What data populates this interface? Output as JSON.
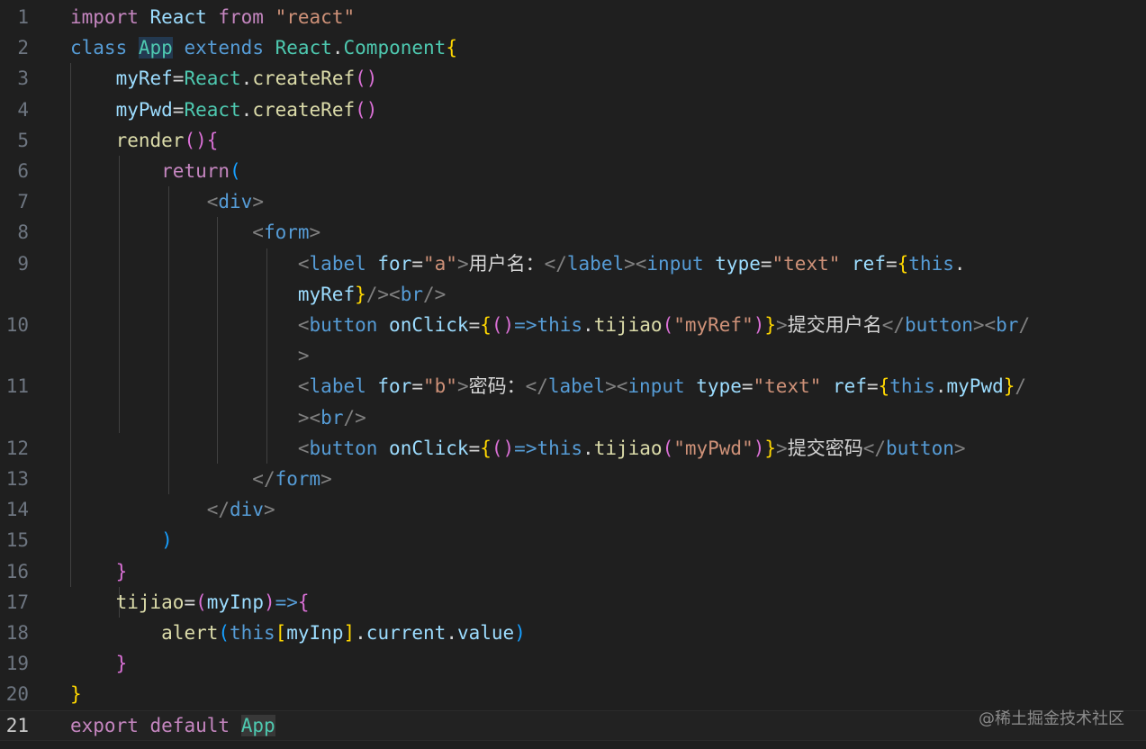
{
  "editor": {
    "current_line": "21",
    "watermark": "@稀土掘金技术社区",
    "lines": [
      {
        "num": "1",
        "tokens": [
          {
            "t": "import",
            "c": "kw-ctrl"
          },
          {
            "t": " React ",
            "c": "var"
          },
          {
            "t": "from",
            "c": "kw-ctrl"
          },
          {
            "t": " ",
            "c": "txt"
          },
          {
            "t": "\"react\"",
            "c": "str"
          }
        ]
      },
      {
        "num": "2",
        "tokens": [
          {
            "t": "class",
            "c": "kw"
          },
          {
            "t": " ",
            "c": "txt"
          },
          {
            "t": "App",
            "c": "cls hl"
          },
          {
            "t": " ",
            "c": "txt"
          },
          {
            "t": "extends",
            "c": "kw"
          },
          {
            "t": " ",
            "c": "txt"
          },
          {
            "t": "React",
            "c": "cls"
          },
          {
            "t": ".",
            "c": "txt"
          },
          {
            "t": "Component",
            "c": "cls"
          },
          {
            "t": "{",
            "c": "b1"
          }
        ]
      },
      {
        "num": "3",
        "tokens": [
          {
            "t": "    ",
            "c": "txt"
          },
          {
            "t": "myRef",
            "c": "var"
          },
          {
            "t": "=",
            "c": "op"
          },
          {
            "t": "React",
            "c": "cls"
          },
          {
            "t": ".",
            "c": "txt"
          },
          {
            "t": "createRef",
            "c": "fn"
          },
          {
            "t": "()",
            "c": "b2"
          }
        ]
      },
      {
        "num": "4",
        "tokens": [
          {
            "t": "    ",
            "c": "txt"
          },
          {
            "t": "myPwd",
            "c": "var"
          },
          {
            "t": "=",
            "c": "op"
          },
          {
            "t": "React",
            "c": "cls"
          },
          {
            "t": ".",
            "c": "txt"
          },
          {
            "t": "createRef",
            "c": "fn"
          },
          {
            "t": "()",
            "c": "b2"
          }
        ]
      },
      {
        "num": "5",
        "tokens": [
          {
            "t": "    ",
            "c": "txt"
          },
          {
            "t": "render",
            "c": "fn"
          },
          {
            "t": "(){",
            "c": "b2"
          }
        ]
      },
      {
        "num": "6",
        "tokens": [
          {
            "t": "        ",
            "c": "txt"
          },
          {
            "t": "return",
            "c": "kw-ctrl"
          },
          {
            "t": "(",
            "c": "b3"
          }
        ]
      },
      {
        "num": "7",
        "tokens": [
          {
            "t": "            ",
            "c": "txt"
          },
          {
            "t": "<",
            "c": "punc"
          },
          {
            "t": "div",
            "c": "tag"
          },
          {
            "t": ">",
            "c": "punc"
          }
        ]
      },
      {
        "num": "8",
        "tokens": [
          {
            "t": "                ",
            "c": "txt"
          },
          {
            "t": "<",
            "c": "punc"
          },
          {
            "t": "form",
            "c": "tag"
          },
          {
            "t": ">",
            "c": "punc"
          }
        ]
      },
      {
        "num": "9",
        "tokens": [
          {
            "t": "                    ",
            "c": "txt"
          },
          {
            "t": "<",
            "c": "punc"
          },
          {
            "t": "label",
            "c": "tag"
          },
          {
            "t": " ",
            "c": "txt"
          },
          {
            "t": "for",
            "c": "attr"
          },
          {
            "t": "=",
            "c": "op"
          },
          {
            "t": "\"a\"",
            "c": "str"
          },
          {
            "t": ">",
            "c": "punc"
          },
          {
            "t": "用户名：",
            "c": "txt"
          },
          {
            "t": "</",
            "c": "punc"
          },
          {
            "t": "label",
            "c": "tag"
          },
          {
            "t": "><",
            "c": "punc"
          },
          {
            "t": "input",
            "c": "tag"
          },
          {
            "t": " ",
            "c": "txt"
          },
          {
            "t": "type",
            "c": "attr"
          },
          {
            "t": "=",
            "c": "op"
          },
          {
            "t": "\"text\"",
            "c": "str"
          },
          {
            "t": " ",
            "c": "txt"
          },
          {
            "t": "ref",
            "c": "attr"
          },
          {
            "t": "=",
            "c": "op"
          },
          {
            "t": "{",
            "c": "b1"
          },
          {
            "t": "this",
            "c": "kw"
          },
          {
            "t": ".",
            "c": "txt"
          }
        ]
      },
      {
        "num": "",
        "tokens": [
          {
            "t": "                    ",
            "c": "txt"
          },
          {
            "t": "myRef",
            "c": "var"
          },
          {
            "t": "}",
            "c": "b1"
          },
          {
            "t": "/><",
            "c": "punc"
          },
          {
            "t": "br",
            "c": "tag"
          },
          {
            "t": "/>",
            "c": "punc"
          }
        ]
      },
      {
        "num": "10",
        "tokens": [
          {
            "t": "                    ",
            "c": "txt"
          },
          {
            "t": "<",
            "c": "punc"
          },
          {
            "t": "button",
            "c": "tag"
          },
          {
            "t": " ",
            "c": "txt"
          },
          {
            "t": "onClick",
            "c": "attr"
          },
          {
            "t": "=",
            "c": "op"
          },
          {
            "t": "{",
            "c": "b1"
          },
          {
            "t": "()",
            "c": "b2"
          },
          {
            "t": "=>",
            "c": "kw"
          },
          {
            "t": "this",
            "c": "kw"
          },
          {
            "t": ".",
            "c": "txt"
          },
          {
            "t": "tijiao",
            "c": "fn"
          },
          {
            "t": "(",
            "c": "b2"
          },
          {
            "t": "\"myRef\"",
            "c": "str"
          },
          {
            "t": ")",
            "c": "b2"
          },
          {
            "t": "}",
            "c": "b1"
          },
          {
            "t": ">",
            "c": "punc"
          },
          {
            "t": "提交用户名",
            "c": "txt"
          },
          {
            "t": "</",
            "c": "punc"
          },
          {
            "t": "button",
            "c": "tag"
          },
          {
            "t": "><",
            "c": "punc"
          },
          {
            "t": "br",
            "c": "tag"
          },
          {
            "t": "/",
            "c": "punc"
          }
        ]
      },
      {
        "num": "",
        "tokens": [
          {
            "t": "                    ",
            "c": "txt"
          },
          {
            "t": ">",
            "c": "punc"
          }
        ]
      },
      {
        "num": "11",
        "tokens": [
          {
            "t": "                    ",
            "c": "txt"
          },
          {
            "t": "<",
            "c": "punc"
          },
          {
            "t": "label",
            "c": "tag"
          },
          {
            "t": " ",
            "c": "txt"
          },
          {
            "t": "for",
            "c": "attr"
          },
          {
            "t": "=",
            "c": "op"
          },
          {
            "t": "\"b\"",
            "c": "str"
          },
          {
            "t": ">",
            "c": "punc"
          },
          {
            "t": "密码：",
            "c": "txt"
          },
          {
            "t": "</",
            "c": "punc"
          },
          {
            "t": "label",
            "c": "tag"
          },
          {
            "t": "><",
            "c": "punc"
          },
          {
            "t": "input",
            "c": "tag"
          },
          {
            "t": " ",
            "c": "txt"
          },
          {
            "t": "type",
            "c": "attr"
          },
          {
            "t": "=",
            "c": "op"
          },
          {
            "t": "\"text\"",
            "c": "str"
          },
          {
            "t": " ",
            "c": "txt"
          },
          {
            "t": "ref",
            "c": "attr"
          },
          {
            "t": "=",
            "c": "op"
          },
          {
            "t": "{",
            "c": "b1"
          },
          {
            "t": "this",
            "c": "kw"
          },
          {
            "t": ".",
            "c": "txt"
          },
          {
            "t": "myPwd",
            "c": "var"
          },
          {
            "t": "}",
            "c": "b1"
          },
          {
            "t": "/",
            "c": "punc"
          }
        ]
      },
      {
        "num": "",
        "tokens": [
          {
            "t": "                    ",
            "c": "txt"
          },
          {
            "t": "><",
            "c": "punc"
          },
          {
            "t": "br",
            "c": "tag"
          },
          {
            "t": "/>",
            "c": "punc"
          }
        ]
      },
      {
        "num": "12",
        "tokens": [
          {
            "t": "                    ",
            "c": "txt"
          },
          {
            "t": "<",
            "c": "punc"
          },
          {
            "t": "button",
            "c": "tag"
          },
          {
            "t": " ",
            "c": "txt"
          },
          {
            "t": "onClick",
            "c": "attr"
          },
          {
            "t": "=",
            "c": "op"
          },
          {
            "t": "{",
            "c": "b1"
          },
          {
            "t": "()",
            "c": "b2"
          },
          {
            "t": "=>",
            "c": "kw"
          },
          {
            "t": "this",
            "c": "kw"
          },
          {
            "t": ".",
            "c": "txt"
          },
          {
            "t": "tijiao",
            "c": "fn"
          },
          {
            "t": "(",
            "c": "b2"
          },
          {
            "t": "\"myPwd\"",
            "c": "str"
          },
          {
            "t": ")",
            "c": "b2"
          },
          {
            "t": "}",
            "c": "b1"
          },
          {
            "t": ">",
            "c": "punc"
          },
          {
            "t": "提交密码",
            "c": "txt"
          },
          {
            "t": "</",
            "c": "punc"
          },
          {
            "t": "button",
            "c": "tag"
          },
          {
            "t": ">",
            "c": "punc"
          }
        ]
      },
      {
        "num": "13",
        "tokens": [
          {
            "t": "                ",
            "c": "txt"
          },
          {
            "t": "</",
            "c": "punc"
          },
          {
            "t": "form",
            "c": "tag"
          },
          {
            "t": ">",
            "c": "punc"
          }
        ]
      },
      {
        "num": "14",
        "tokens": [
          {
            "t": "            ",
            "c": "txt"
          },
          {
            "t": "</",
            "c": "punc"
          },
          {
            "t": "div",
            "c": "tag"
          },
          {
            "t": ">",
            "c": "punc"
          }
        ]
      },
      {
        "num": "15",
        "tokens": [
          {
            "t": "        ",
            "c": "txt"
          },
          {
            "t": ")",
            "c": "b3"
          }
        ]
      },
      {
        "num": "16",
        "tokens": [
          {
            "t": "    ",
            "c": "txt"
          },
          {
            "t": "}",
            "c": "b2"
          }
        ]
      },
      {
        "num": "17",
        "tokens": [
          {
            "t": "    ",
            "c": "txt"
          },
          {
            "t": "tijiao",
            "c": "fn"
          },
          {
            "t": "=",
            "c": "op"
          },
          {
            "t": "(",
            "c": "b2"
          },
          {
            "t": "myInp",
            "c": "var"
          },
          {
            "t": ")",
            "c": "b2"
          },
          {
            "t": "=>",
            "c": "kw"
          },
          {
            "t": "{",
            "c": "b2"
          }
        ]
      },
      {
        "num": "18",
        "tokens": [
          {
            "t": "        ",
            "c": "txt"
          },
          {
            "t": "alert",
            "c": "fn"
          },
          {
            "t": "(",
            "c": "b3"
          },
          {
            "t": "this",
            "c": "kw"
          },
          {
            "t": "[",
            "c": "b1"
          },
          {
            "t": "myInp",
            "c": "var"
          },
          {
            "t": "]",
            "c": "b1"
          },
          {
            "t": ".",
            "c": "txt"
          },
          {
            "t": "current",
            "c": "var"
          },
          {
            "t": ".",
            "c": "txt"
          },
          {
            "t": "value",
            "c": "var"
          },
          {
            "t": ")",
            "c": "b3"
          }
        ]
      },
      {
        "num": "19",
        "tokens": [
          {
            "t": "    ",
            "c": "txt"
          },
          {
            "t": "}",
            "c": "b2"
          }
        ]
      },
      {
        "num": "20",
        "tokens": [
          {
            "t": "}",
            "c": "b1"
          }
        ]
      },
      {
        "num": "21",
        "tokens": [
          {
            "t": "export",
            "c": "kw-ctrl"
          },
          {
            "t": " ",
            "c": "txt"
          },
          {
            "t": "default",
            "c": "kw-ctrl"
          },
          {
            "t": " ",
            "c": "txt"
          },
          {
            "t": "App",
            "c": "cls hl2"
          }
        ]
      }
    ]
  }
}
